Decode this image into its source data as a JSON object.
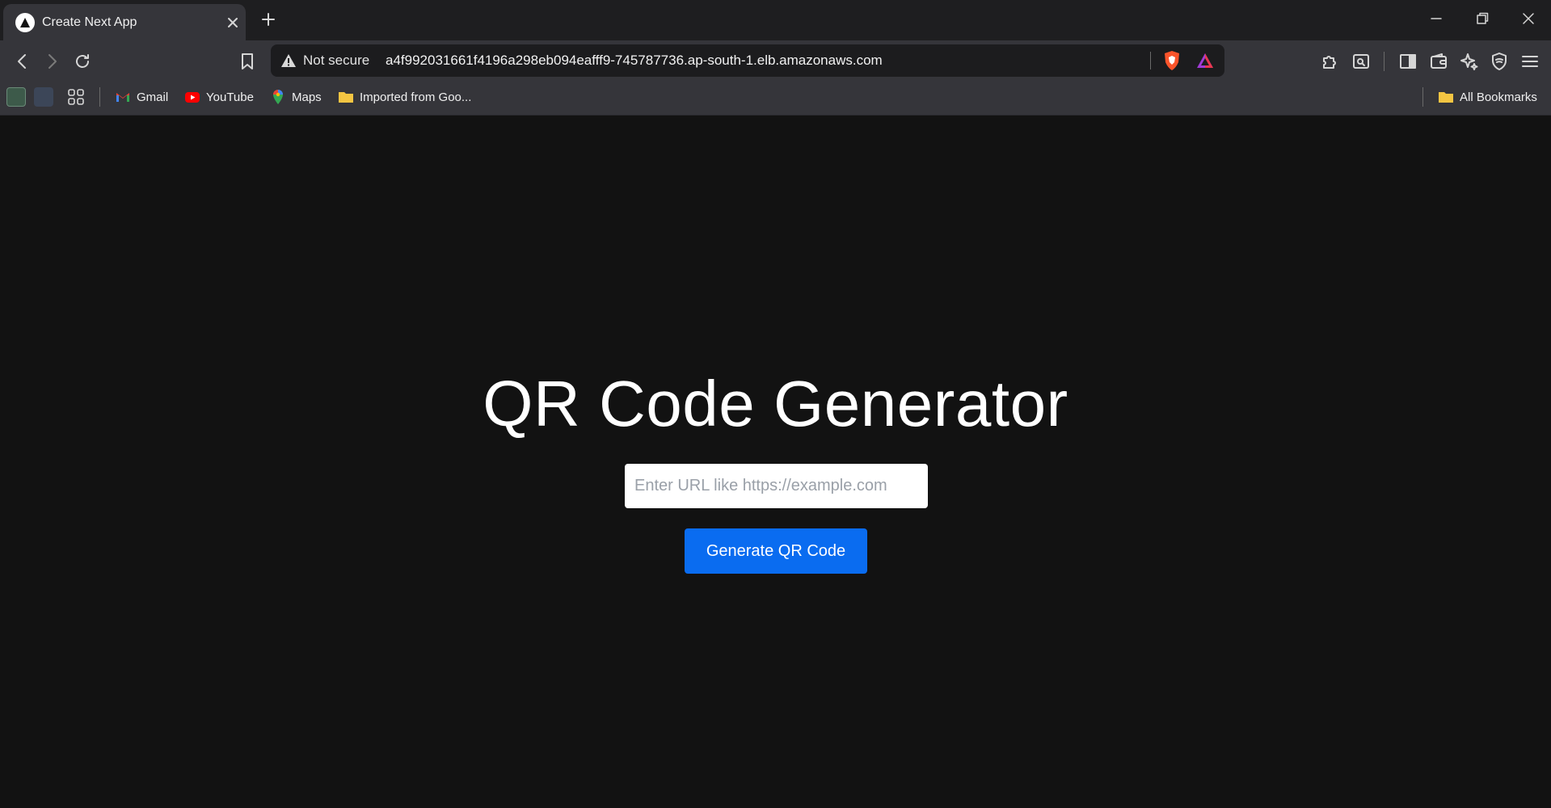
{
  "browser": {
    "tab": {
      "title": "Create Next App"
    },
    "address_bar": {
      "security_label": "Not secure",
      "url": "a4f992031661f4196a298eb094eafff9-745787736.ap-south-1.elb.amazonaws.com"
    },
    "bookmarks": {
      "items": [
        "Gmail",
        "YouTube",
        "Maps",
        "Imported from Goo..."
      ],
      "all_bookmarks": "All Bookmarks"
    }
  },
  "page": {
    "title": "QR Code Generator",
    "url_input": {
      "placeholder": "Enter URL like https://example.com",
      "value": ""
    },
    "generate_button": "Generate QR Code"
  },
  "colors": {
    "page_background": "#121212",
    "button_background": "#0a6cf0",
    "tab_active": "#35353a"
  }
}
